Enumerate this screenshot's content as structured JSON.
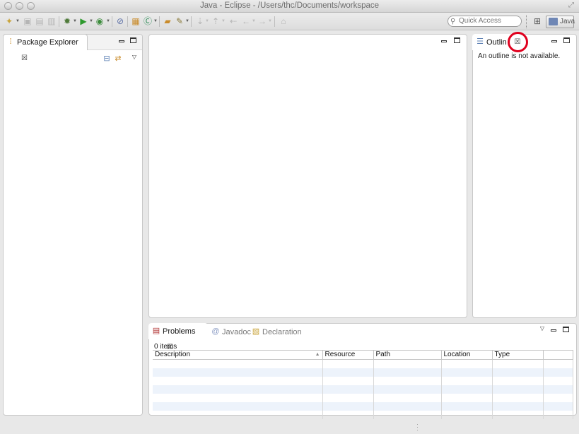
{
  "window": {
    "title": "Java - Eclipse - /Users/thc/Documents/workspace"
  },
  "toolbar": {
    "icons": [
      "new-icon",
      "save-icon",
      "save-all-icon",
      "print-icon",
      "debug-icon",
      "run-icon",
      "external-tools-icon",
      "skip-breakpoints-icon",
      "new-java-project-icon",
      "new-class-icon",
      "open-type-icon",
      "search-icon",
      "next-annotation-icon",
      "prev-annotation-icon",
      "back-icon",
      "forward-icon",
      "pin-editor-icon"
    ],
    "quick_access_placeholder": "Quick Access",
    "perspective_label": "Java"
  },
  "package_explorer": {
    "tab_label": "Package Explorer"
  },
  "outline": {
    "tab_label": "Outlin",
    "message": "An outline is not available."
  },
  "bottom": {
    "tabs": [
      {
        "label": "Problems",
        "active": true
      },
      {
        "label": "Javadoc",
        "active": false
      },
      {
        "label": "Declaration",
        "active": false
      }
    ],
    "items_count": "0 items",
    "columns": [
      "Description",
      "Resource",
      "Path",
      "Location",
      "Type"
    ]
  },
  "colors": {
    "annotation_circle": "#e0001e",
    "alt_row": "#edf3fb"
  }
}
